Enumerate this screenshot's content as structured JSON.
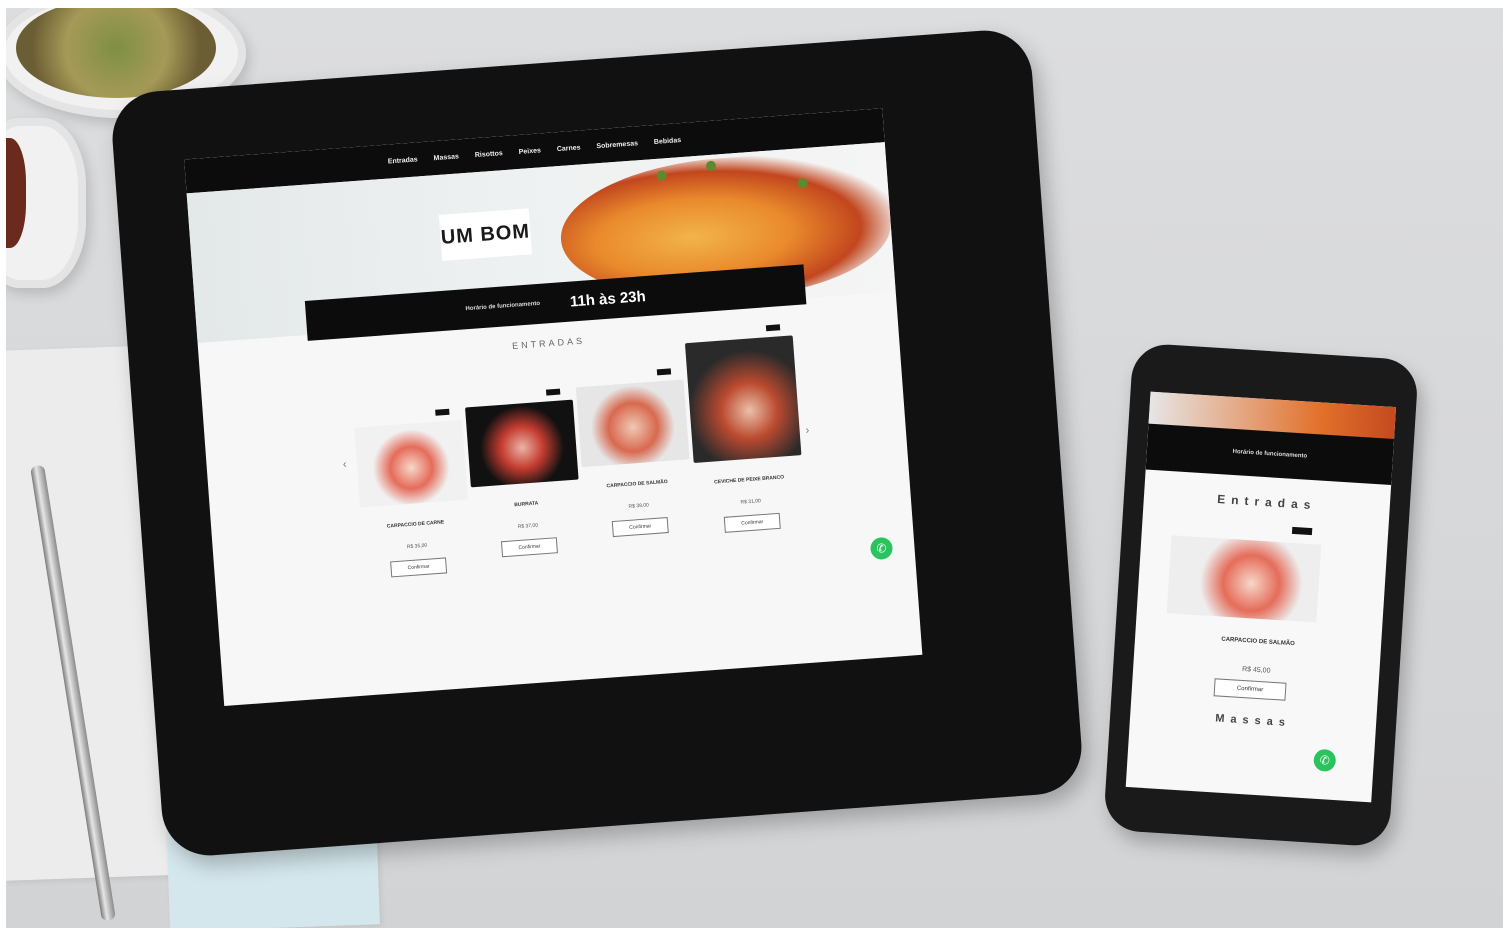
{
  "tablet_site": {
    "nav": [
      "Entradas",
      "Massas",
      "Risottos",
      "Peixes",
      "Carnes",
      "Sobremesas",
      "Bebidas"
    ],
    "logo": "UM BOM",
    "hours_label": "Horário de funcionamento",
    "hours": "11h às 23h",
    "section_title": "ENTRADAS",
    "cards": [
      {
        "name": "CARPACCIO DE CARNE",
        "price": "R$ 35,00",
        "button": "Confirmar"
      },
      {
        "name": "BURRATA",
        "price": "R$ 37,00",
        "button": "Confirmar"
      },
      {
        "name": "CARPACCIO DE SALMÃO",
        "price": "R$ 39,00",
        "button": "Confirmar"
      },
      {
        "name": "CEVICHE DE PEIXE BRANCO",
        "price": "R$ 31,00",
        "button": "Confirmar"
      }
    ]
  },
  "phone_site": {
    "hours_label": "Horário de funcionamento",
    "section_title": "Entradas",
    "card_name": "CARPACCIO DE SALMÃO",
    "card_price": "R$ 45,00",
    "card_button": "Confirmar",
    "next_section": "Massas"
  },
  "icons": [
    "whatsapp-icon",
    "arrow-left-icon",
    "arrow-right-icon"
  ],
  "colors": {
    "whatsapp": "#2ac45e",
    "bar": "#0c0c0c"
  }
}
